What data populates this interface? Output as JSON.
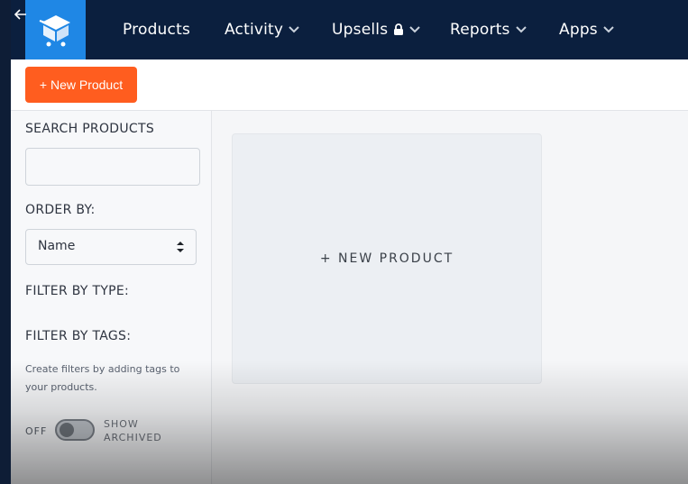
{
  "nav": {
    "items": [
      {
        "label": "Products",
        "has_chevron": false,
        "locked": false
      },
      {
        "label": "Activity",
        "has_chevron": true,
        "locked": false
      },
      {
        "label": "Upsells",
        "has_chevron": true,
        "locked": true
      },
      {
        "label": "Reports",
        "has_chevron": true,
        "locked": false
      },
      {
        "label": "Apps",
        "has_chevron": true,
        "locked": false
      }
    ],
    "logo_icon": "box-cart-icon",
    "back_icon": "arrow-left-icon",
    "colors": {
      "nav_bg": "#0b1f3e",
      "logo_bg": "#1f87e5"
    }
  },
  "toolbar": {
    "new_product_label": "+ New Product",
    "accent": "#ff5d1f"
  },
  "sidebar": {
    "search_label": "SEARCH PRODUCTS",
    "search_value": "",
    "order_label": "ORDER BY:",
    "order_value": "Name",
    "filter_type_label": "FILTER BY TYPE:",
    "filter_tags_label": "FILTER BY TAGS:",
    "tags_hint": "Create filters by adding tags to your products.",
    "toggle_state_label": "OFF",
    "toggle_label_line1": "SHOW",
    "toggle_label_line2": "ARCHIVED"
  },
  "main": {
    "new_product_card_label": "+ NEW PRODUCT"
  }
}
